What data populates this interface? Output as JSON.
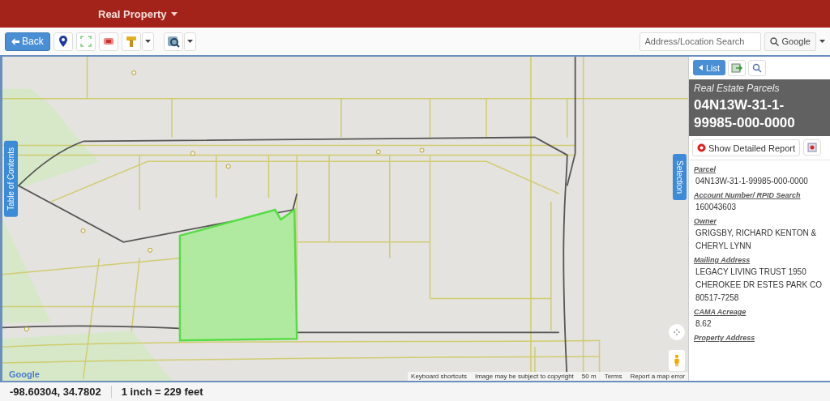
{
  "header": {
    "title": "Real Property"
  },
  "toolbar": {
    "back_button": "Back",
    "search": {
      "placeholder": "Address/Location Search"
    },
    "search_provider": "Google"
  },
  "map": {
    "side_tabs": [
      {
        "label": "Table of Contents",
        "kind": "left"
      },
      {
        "label": "Selection",
        "kind": "right"
      }
    ],
    "attribution": [
      "Keyboard shortcuts",
      "Image may be subject to copyright",
      "50 m",
      "Terms",
      "Report a map error"
    ],
    "logo": "Google"
  },
  "panel": {
    "list_button": "List",
    "layer": "Real Estate Parcels",
    "title": "04N13W-31-1-99985-000-0000",
    "report_button": "Show Detailed Report",
    "fields": [
      {
        "label": "Parcel",
        "value": "04N13W-31-1-99985-000-0000"
      },
      {
        "label": "Account Number/ RPID Search",
        "value": "160043603"
      },
      {
        "label": "Owner",
        "value": "GRIGSBY, RICHARD KENTON & CHERYL LYNN"
      },
      {
        "label": "Mailing Address",
        "value": "LEGACY LIVING TRUST 1950 CHEROKEE DR ESTES PARK CO 80517-7258"
      },
      {
        "label": "CAMA Acreage",
        "value": "8.62"
      },
      {
        "label": "Property Address"
      }
    ]
  },
  "status_bar": {
    "coordinates": "-98.60304, 34.7802",
    "scale": "1 inch = 229 feet"
  }
}
